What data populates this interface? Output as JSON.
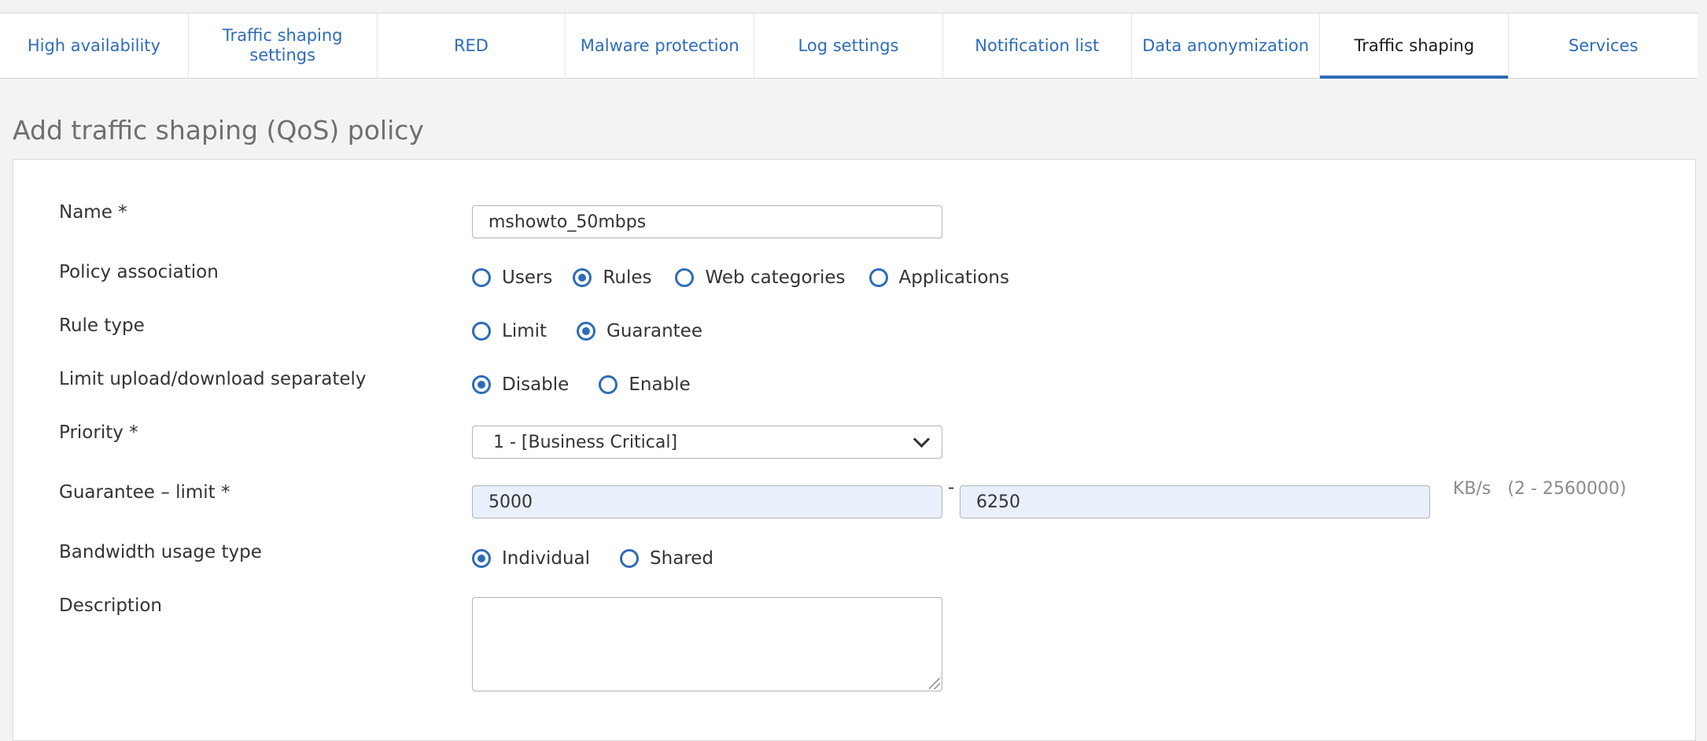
{
  "tabs": [
    {
      "label": "High availability"
    },
    {
      "label": "Traffic shaping settings"
    },
    {
      "label": "RED"
    },
    {
      "label": "Malware protection"
    },
    {
      "label": "Log settings"
    },
    {
      "label": "Notification list"
    },
    {
      "label": "Data anonymization"
    },
    {
      "label": "Traffic shaping",
      "active": true
    },
    {
      "label": "Services"
    }
  ],
  "page_title": "Add traffic shaping (QoS) policy",
  "form": {
    "name": {
      "label": "Name *",
      "value": "mshowto_50mbps"
    },
    "policy_association": {
      "label": "Policy association",
      "options": [
        "Users",
        "Rules",
        "Web categories",
        "Applications"
      ],
      "selected": "Rules"
    },
    "rule_type": {
      "label": "Rule type",
      "options": [
        "Limit",
        "Guarantee"
      ],
      "selected": "Guarantee"
    },
    "limit_separately": {
      "label": "Limit upload/download separately",
      "options": [
        "Disable",
        "Enable"
      ],
      "selected": "Disable"
    },
    "priority": {
      "label": "Priority *",
      "value": "1 - [Business Critical]"
    },
    "guarantee_limit": {
      "label": "Guarantee – limit  *",
      "min": "5000",
      "separator": "-",
      "max": "6250",
      "unit": "KB/s   (2 - 2560000)"
    },
    "bandwidth_usage": {
      "label": "Bandwidth usage type",
      "options": [
        "Individual",
        "Shared"
      ],
      "selected": "Individual"
    },
    "description": {
      "label": "Description",
      "value": ""
    }
  },
  "colors": {
    "accent": "#2e6cb8",
    "field_fill": "#e9f0fb",
    "page_bg": "#f3f3f3"
  }
}
